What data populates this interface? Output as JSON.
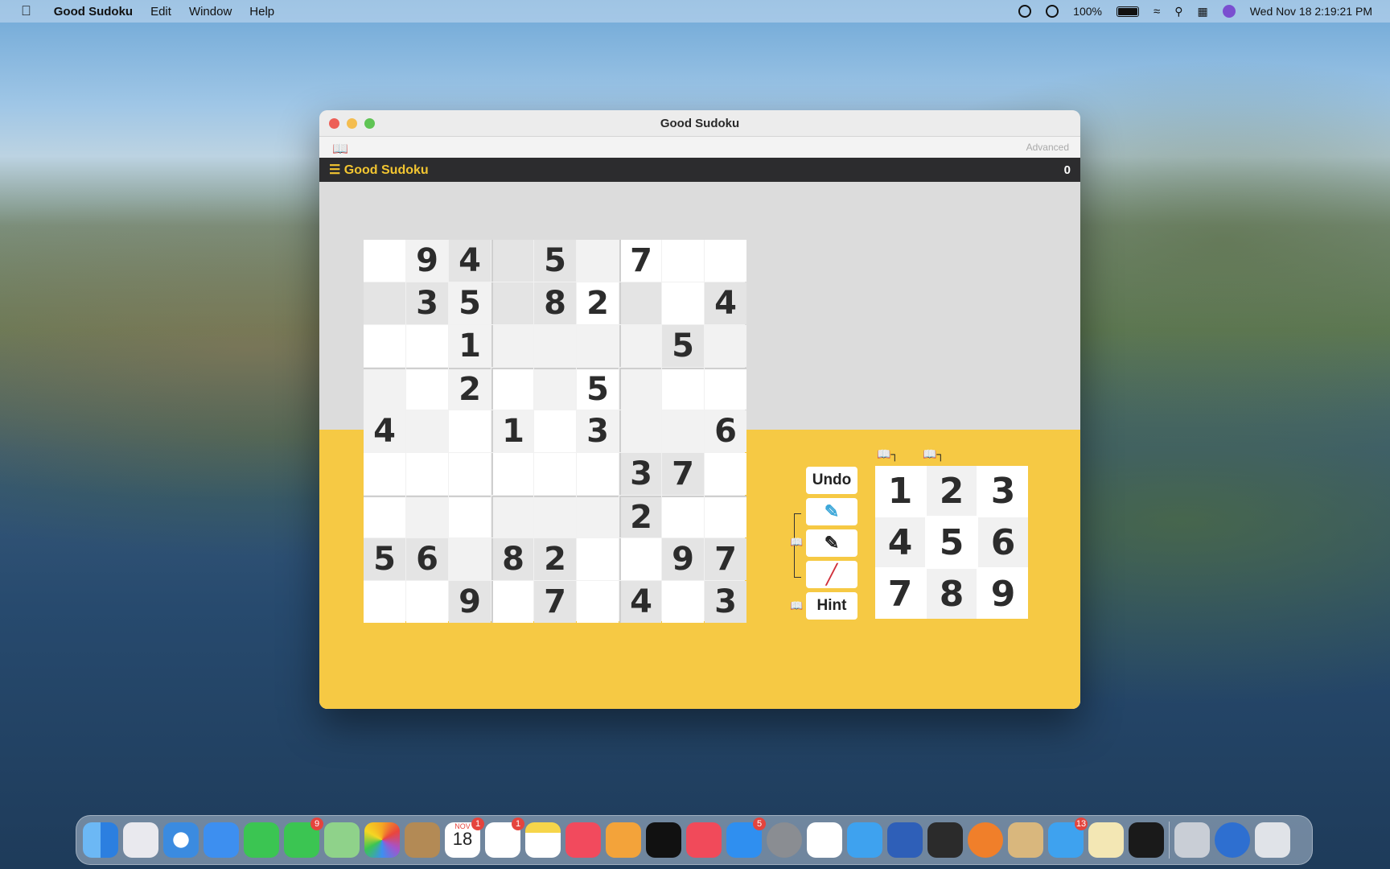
{
  "menubar": {
    "app_name": "Good Sudoku",
    "items": [
      "Edit",
      "Window",
      "Help"
    ],
    "battery": "100%",
    "datetime": "Wed Nov 18  2:19:21 PM"
  },
  "window": {
    "title": "Good Sudoku",
    "toolbar_right": "Advanced",
    "brand": "☰ Good Sudoku",
    "score": "0"
  },
  "board": {
    "rows": [
      [
        "",
        "9",
        "4",
        "",
        "5",
        "",
        "7",
        "",
        ""
      ],
      [
        "",
        "3",
        "5",
        "",
        "8",
        "2",
        "",
        "",
        "4"
      ],
      [
        "",
        "",
        "1",
        "",
        "",
        "",
        "",
        "5",
        ""
      ],
      [
        "",
        "",
        "2",
        "",
        "",
        "5",
        "",
        "",
        ""
      ],
      [
        "4",
        "",
        "",
        "1",
        "",
        "3",
        "",
        "",
        "6"
      ],
      [
        "",
        "",
        "",
        "",
        "",
        "",
        "3",
        "7",
        ""
      ],
      [
        "",
        "",
        "",
        "",
        "",
        "",
        "2",
        "",
        ""
      ],
      [
        "5",
        "6",
        "",
        "8",
        "2",
        "",
        "",
        "9",
        "7"
      ],
      [
        "",
        "",
        "9",
        "",
        "7",
        "",
        "4",
        "",
        "3"
      ]
    ]
  },
  "controls": {
    "undo": "Undo",
    "hint": "Hint"
  },
  "numpad": [
    "1",
    "2",
    "3",
    "4",
    "5",
    "6",
    "7",
    "8",
    "9"
  ],
  "dock": {
    "badges": {
      "messages": "9",
      "calendar": "1",
      "reminders": "1",
      "appstore": "5",
      "twitter2": "13"
    },
    "calendar_month": "NOV",
    "calendar_day": "18"
  },
  "colors": {
    "accent_yellow": "#f6c944",
    "app_bar": "#2c2c2e"
  }
}
